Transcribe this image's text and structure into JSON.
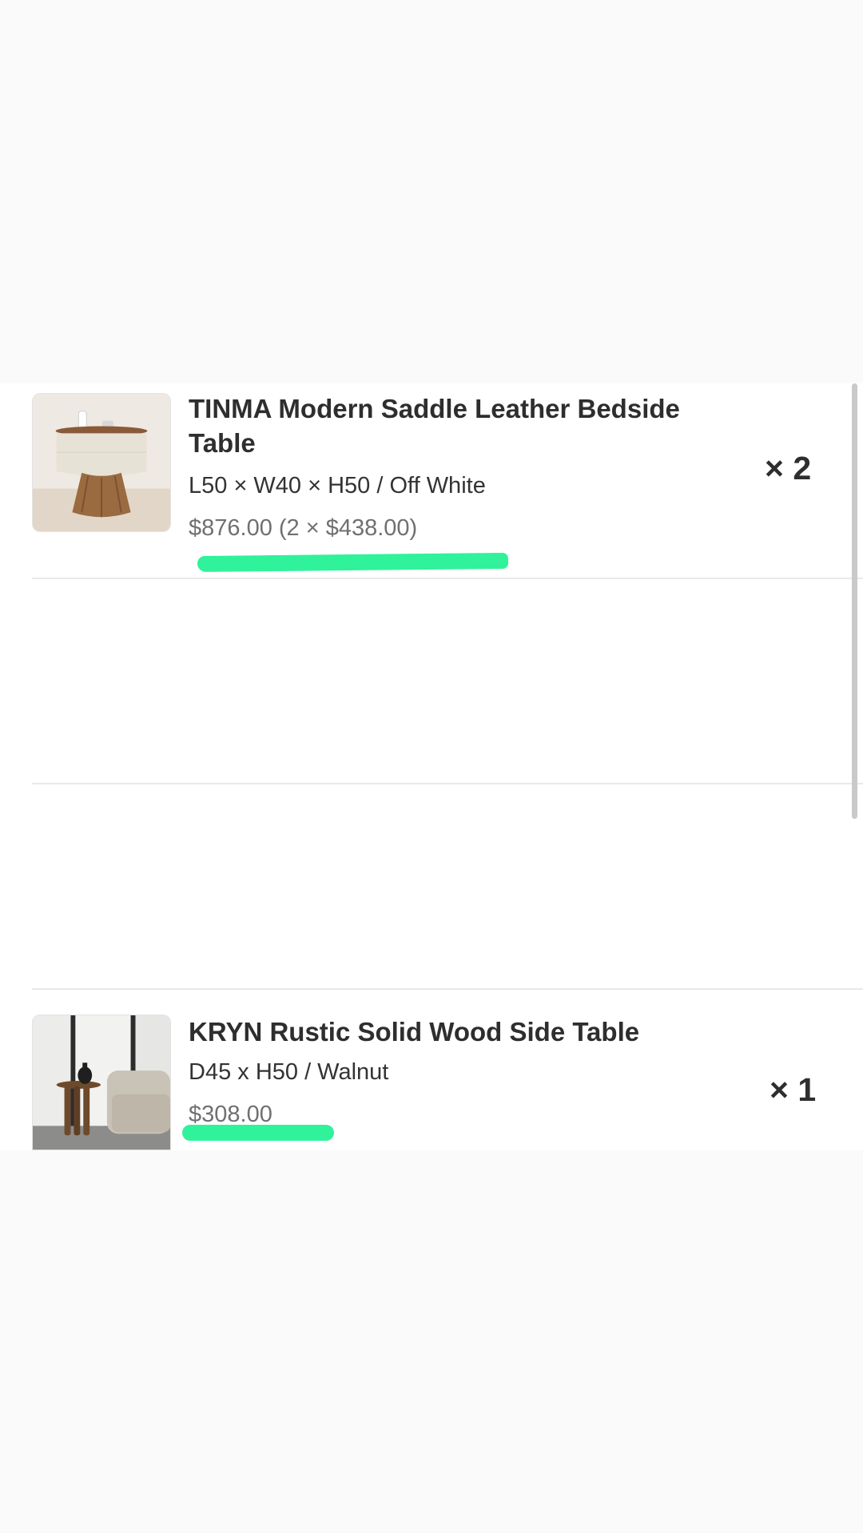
{
  "cart": {
    "items": [
      {
        "title": "TINMA Modern Saddle Leather Bedside Table",
        "variant": "L50 × W40 × H50 / Off White",
        "price": "$876.00 (2 × $438.00)",
        "quantity": "× 2",
        "icon": "bedside-table-photo"
      },
      {
        "title": "KRYN Rustic Solid Wood Side Table",
        "variant": "D45 x H50 / Walnut",
        "price": "$308.00",
        "quantity": "× 1",
        "icon": "side-table-photo"
      }
    ]
  },
  "colors": {
    "highlight": "#2ff29a",
    "background": "#fafafa",
    "panel": "#ffffff",
    "divider": "#e9e9e9"
  }
}
